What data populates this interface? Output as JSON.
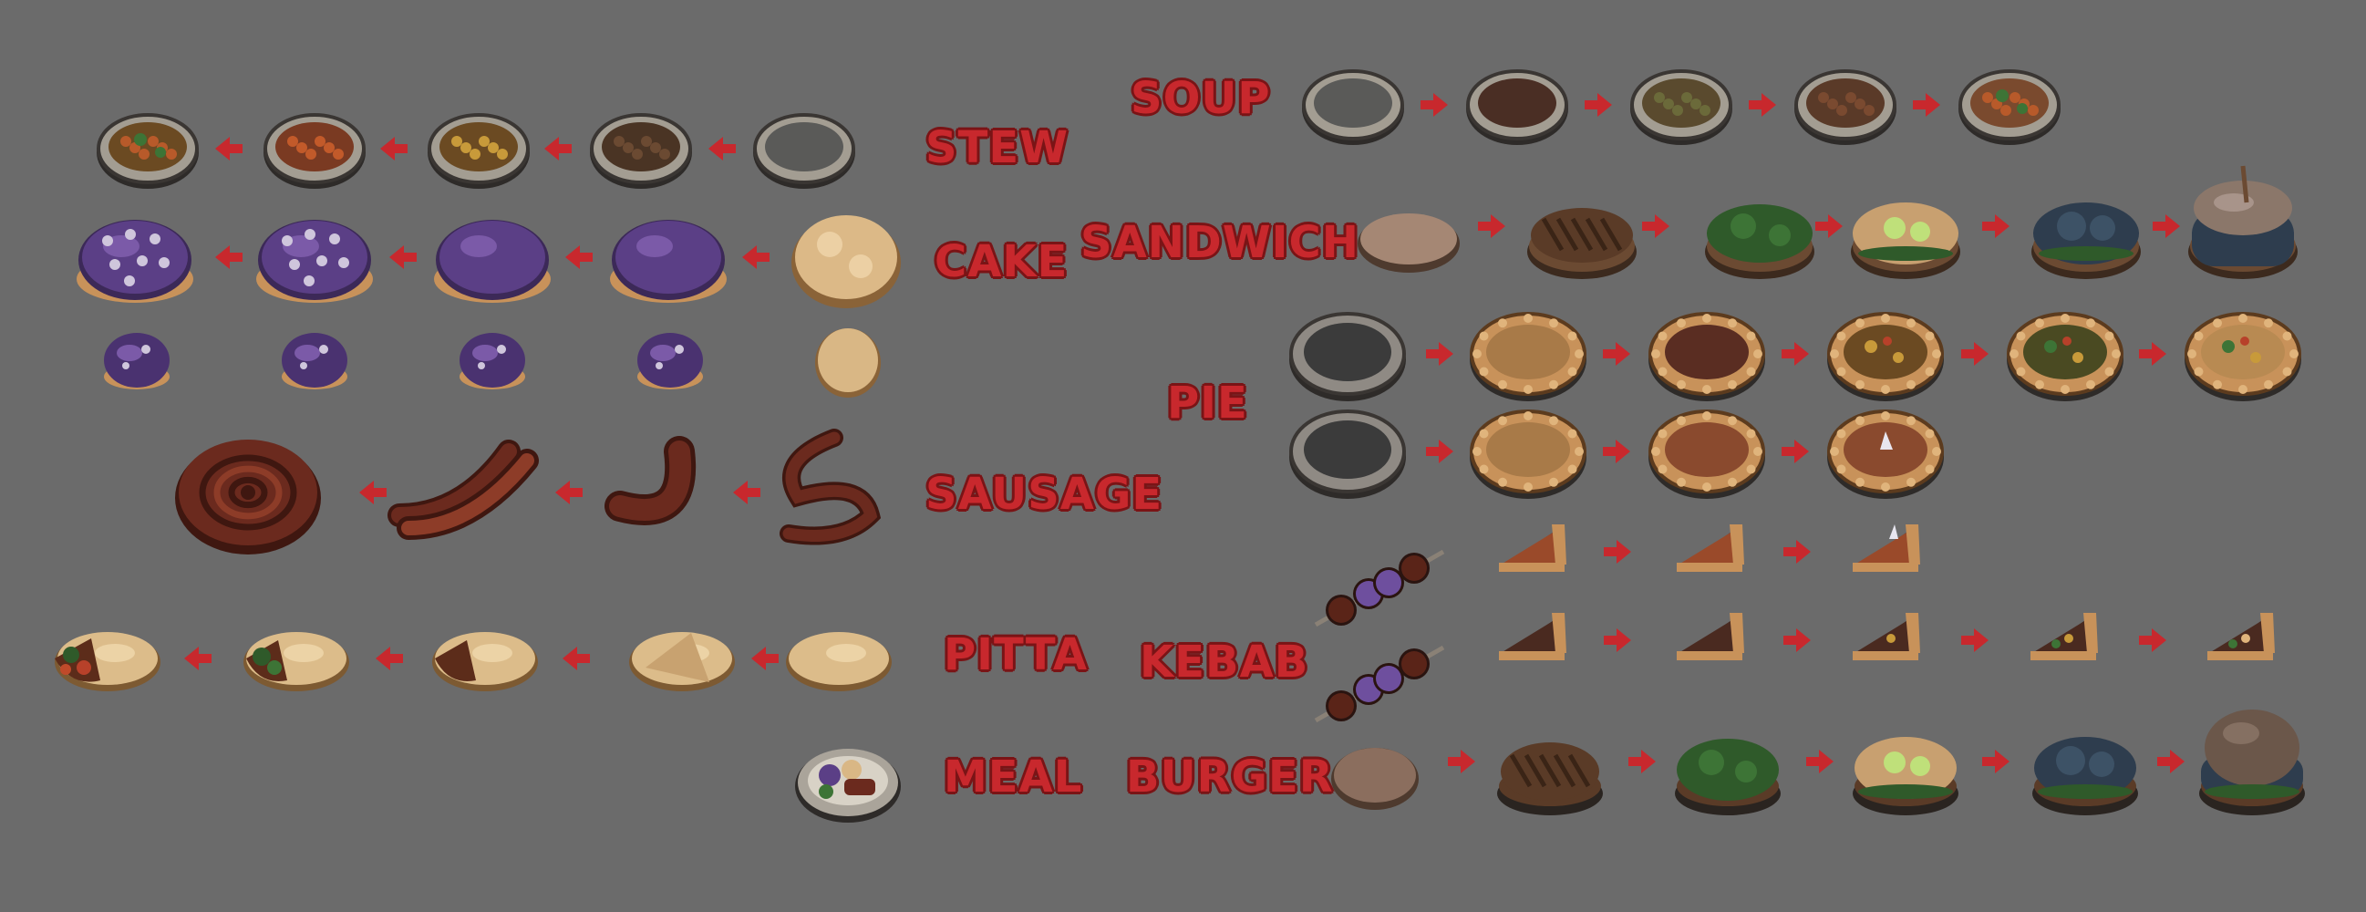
{
  "labels": {
    "soup": "SOUP",
    "stew": "STEW",
    "cake": "CAKE",
    "sandwich": "SANDWICH",
    "pie": "PIE",
    "sausage": "SAUSAGE",
    "pitta": "PITTA",
    "kebab": "KEBAB",
    "meal": "MEAL",
    "burger": "BURGER"
  },
  "icons": {
    "arrow": "arrow-icon",
    "bowl": "bowl-icon",
    "cake": "cake-icon",
    "sausage": "sausage-icon",
    "pitta": "pitta-icon",
    "meal": "meal-plate-icon",
    "sandwich": "sandwich-icon",
    "pie": "pie-icon",
    "pie_slice": "pie-slice-icon",
    "kebab": "kebab-icon",
    "burger": "burger-icon"
  },
  "colors": {
    "background": "#6b6b6b",
    "label": "#c8282d",
    "label_outline": "#7a1416",
    "arrow": "#c8282d",
    "bowl_rim": "#9a9488",
    "purple": "#5b3f86",
    "dough": "#d8b382",
    "meat": "#6b2a1e",
    "pie_crust": "#c8925a",
    "greens": "#2f5a2a"
  }
}
